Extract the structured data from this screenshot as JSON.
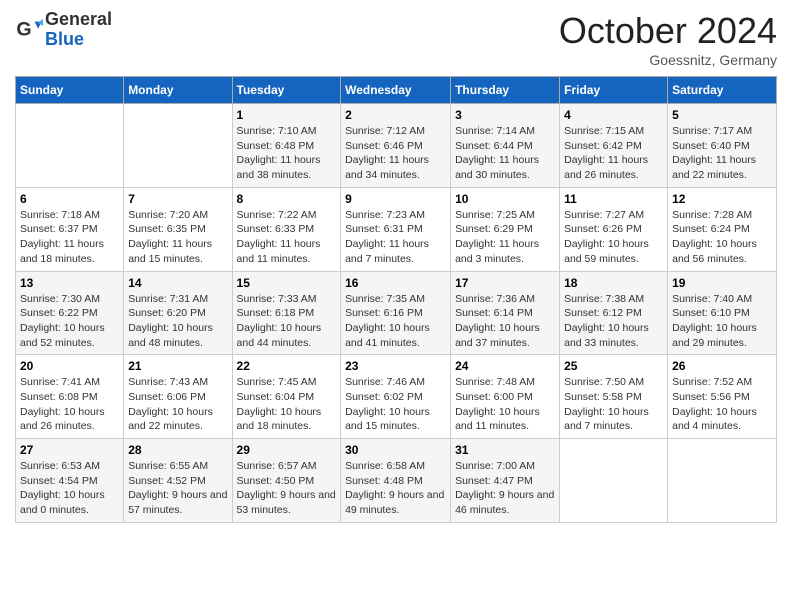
{
  "header": {
    "logo_general": "General",
    "logo_blue": "Blue",
    "month_title": "October 2024",
    "location": "Goessnitz, Germany"
  },
  "weekdays": [
    "Sunday",
    "Monday",
    "Tuesday",
    "Wednesday",
    "Thursday",
    "Friday",
    "Saturday"
  ],
  "weeks": [
    [
      {
        "day": "",
        "info": ""
      },
      {
        "day": "",
        "info": ""
      },
      {
        "day": "1",
        "info": "Sunrise: 7:10 AM\nSunset: 6:48 PM\nDaylight: 11 hours and 38 minutes."
      },
      {
        "day": "2",
        "info": "Sunrise: 7:12 AM\nSunset: 6:46 PM\nDaylight: 11 hours and 34 minutes."
      },
      {
        "day": "3",
        "info": "Sunrise: 7:14 AM\nSunset: 6:44 PM\nDaylight: 11 hours and 30 minutes."
      },
      {
        "day": "4",
        "info": "Sunrise: 7:15 AM\nSunset: 6:42 PM\nDaylight: 11 hours and 26 minutes."
      },
      {
        "day": "5",
        "info": "Sunrise: 7:17 AM\nSunset: 6:40 PM\nDaylight: 11 hours and 22 minutes."
      }
    ],
    [
      {
        "day": "6",
        "info": "Sunrise: 7:18 AM\nSunset: 6:37 PM\nDaylight: 11 hours and 18 minutes."
      },
      {
        "day": "7",
        "info": "Sunrise: 7:20 AM\nSunset: 6:35 PM\nDaylight: 11 hours and 15 minutes."
      },
      {
        "day": "8",
        "info": "Sunrise: 7:22 AM\nSunset: 6:33 PM\nDaylight: 11 hours and 11 minutes."
      },
      {
        "day": "9",
        "info": "Sunrise: 7:23 AM\nSunset: 6:31 PM\nDaylight: 11 hours and 7 minutes."
      },
      {
        "day": "10",
        "info": "Sunrise: 7:25 AM\nSunset: 6:29 PM\nDaylight: 11 hours and 3 minutes."
      },
      {
        "day": "11",
        "info": "Sunrise: 7:27 AM\nSunset: 6:26 PM\nDaylight: 10 hours and 59 minutes."
      },
      {
        "day": "12",
        "info": "Sunrise: 7:28 AM\nSunset: 6:24 PM\nDaylight: 10 hours and 56 minutes."
      }
    ],
    [
      {
        "day": "13",
        "info": "Sunrise: 7:30 AM\nSunset: 6:22 PM\nDaylight: 10 hours and 52 minutes."
      },
      {
        "day": "14",
        "info": "Sunrise: 7:31 AM\nSunset: 6:20 PM\nDaylight: 10 hours and 48 minutes."
      },
      {
        "day": "15",
        "info": "Sunrise: 7:33 AM\nSunset: 6:18 PM\nDaylight: 10 hours and 44 minutes."
      },
      {
        "day": "16",
        "info": "Sunrise: 7:35 AM\nSunset: 6:16 PM\nDaylight: 10 hours and 41 minutes."
      },
      {
        "day": "17",
        "info": "Sunrise: 7:36 AM\nSunset: 6:14 PM\nDaylight: 10 hours and 37 minutes."
      },
      {
        "day": "18",
        "info": "Sunrise: 7:38 AM\nSunset: 6:12 PM\nDaylight: 10 hours and 33 minutes."
      },
      {
        "day": "19",
        "info": "Sunrise: 7:40 AM\nSunset: 6:10 PM\nDaylight: 10 hours and 29 minutes."
      }
    ],
    [
      {
        "day": "20",
        "info": "Sunrise: 7:41 AM\nSunset: 6:08 PM\nDaylight: 10 hours and 26 minutes."
      },
      {
        "day": "21",
        "info": "Sunrise: 7:43 AM\nSunset: 6:06 PM\nDaylight: 10 hours and 22 minutes."
      },
      {
        "day": "22",
        "info": "Sunrise: 7:45 AM\nSunset: 6:04 PM\nDaylight: 10 hours and 18 minutes."
      },
      {
        "day": "23",
        "info": "Sunrise: 7:46 AM\nSunset: 6:02 PM\nDaylight: 10 hours and 15 minutes."
      },
      {
        "day": "24",
        "info": "Sunrise: 7:48 AM\nSunset: 6:00 PM\nDaylight: 10 hours and 11 minutes."
      },
      {
        "day": "25",
        "info": "Sunrise: 7:50 AM\nSunset: 5:58 PM\nDaylight: 10 hours and 7 minutes."
      },
      {
        "day": "26",
        "info": "Sunrise: 7:52 AM\nSunset: 5:56 PM\nDaylight: 10 hours and 4 minutes."
      }
    ],
    [
      {
        "day": "27",
        "info": "Sunrise: 6:53 AM\nSunset: 4:54 PM\nDaylight: 10 hours and 0 minutes."
      },
      {
        "day": "28",
        "info": "Sunrise: 6:55 AM\nSunset: 4:52 PM\nDaylight: 9 hours and 57 minutes."
      },
      {
        "day": "29",
        "info": "Sunrise: 6:57 AM\nSunset: 4:50 PM\nDaylight: 9 hours and 53 minutes."
      },
      {
        "day": "30",
        "info": "Sunrise: 6:58 AM\nSunset: 4:48 PM\nDaylight: 9 hours and 49 minutes."
      },
      {
        "day": "31",
        "info": "Sunrise: 7:00 AM\nSunset: 4:47 PM\nDaylight: 9 hours and 46 minutes."
      },
      {
        "day": "",
        "info": ""
      },
      {
        "day": "",
        "info": ""
      }
    ]
  ]
}
